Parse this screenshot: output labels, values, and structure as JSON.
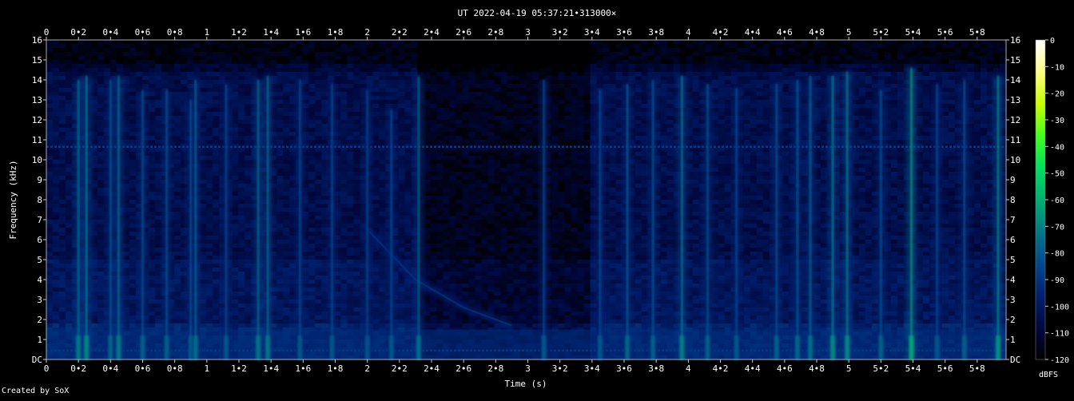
{
  "chart_data": {
    "type": "heatmap",
    "title": "UT 2022-04-19 05:37:21•313000×",
    "xlabel": "Time (s)",
    "ylabel": "Frequency (kHz)",
    "xlim": [
      0,
      5.98
    ],
    "ylim": [
      0,
      16
    ],
    "x_ticks": [
      "0",
      "0•2",
      "0•4",
      "0•6",
      "0•8",
      "1",
      "1•2",
      "1•4",
      "1•6",
      "1•8",
      "2",
      "2•2",
      "2•4",
      "2•6",
      "2•8",
      "3",
      "3•2",
      "3•4",
      "3•6",
      "3•8",
      "4",
      "4•2",
      "4•4",
      "4•6",
      "4•8",
      "5",
      "5•2",
      "5•4",
      "5•6",
      "5•8"
    ],
    "x_tick_values": [
      0,
      0.2,
      0.4,
      0.6,
      0.8,
      1.0,
      1.2,
      1.4,
      1.6,
      1.8,
      2.0,
      2.2,
      2.4,
      2.6,
      2.8,
      3.0,
      3.2,
      3.4,
      3.6,
      3.8,
      4.0,
      4.2,
      4.4,
      4.6,
      4.8,
      5.0,
      5.2,
      5.4,
      5.6,
      5.8
    ],
    "y_ticks": [
      "DC",
      "1",
      "2",
      "3",
      "4",
      "5",
      "6",
      "7",
      "8",
      "9",
      "10",
      "11",
      "12",
      "13",
      "14",
      "15",
      "16"
    ],
    "y_tick_values": [
      0,
      1,
      2,
      3,
      4,
      5,
      6,
      7,
      8,
      9,
      10,
      11,
      12,
      13,
      14,
      15,
      16
    ],
    "colorbar": {
      "label": "dBFS",
      "range": [
        -120,
        0
      ],
      "ticks": [
        "0",
        "-10",
        "-20",
        "-30",
        "-40",
        "-50",
        "-60",
        "-70",
        "-80",
        "-90",
        "-100",
        "-110",
        "-120"
      ],
      "tick_values": [
        0,
        -10,
        -20,
        -30,
        -40,
        -50,
        -60,
        -70,
        -80,
        -90,
        -100,
        -110,
        -120
      ],
      "colors": [
        "#ffffff",
        "#ffff80",
        "#c8ff00",
        "#40ff20",
        "#00e060",
        "#00b070",
        "#007888",
        "#004890",
        "#002070",
        "#000840",
        "#000000"
      ]
    },
    "background_level_dbfs": -110,
    "horizontal_lines": [
      {
        "freq_khz": 10.65,
        "level_dbfs": -88
      },
      {
        "freq_khz": 0.45,
        "level_dbfs": -85
      }
    ],
    "sweep": {
      "description_points_time_s": [
        2.0,
        2.3,
        2.6,
        2.9
      ],
      "description_points_freq_khz": [
        6.5,
        4.0,
        2.6,
        1.7
      ],
      "level_dbfs": -95
    },
    "transients": [
      {
        "t": 0.2,
        "top_khz": 14,
        "level_dbfs": -75
      },
      {
        "t": 0.25,
        "top_khz": 14.2,
        "level_dbfs": -72
      },
      {
        "t": 0.4,
        "top_khz": 14,
        "level_dbfs": -80
      },
      {
        "t": 0.45,
        "top_khz": 14.2,
        "level_dbfs": -75
      },
      {
        "t": 0.6,
        "top_khz": 13.5,
        "level_dbfs": -82
      },
      {
        "t": 0.75,
        "top_khz": 13.5,
        "level_dbfs": -82
      },
      {
        "t": 0.9,
        "top_khz": 13,
        "level_dbfs": -80
      },
      {
        "t": 0.93,
        "top_khz": 14,
        "level_dbfs": -78
      },
      {
        "t": 1.12,
        "top_khz": 13.8,
        "level_dbfs": -84
      },
      {
        "t": 1.32,
        "top_khz": 14,
        "level_dbfs": -76
      },
      {
        "t": 1.38,
        "top_khz": 14.2,
        "level_dbfs": -76
      },
      {
        "t": 1.58,
        "top_khz": 14,
        "level_dbfs": -84
      },
      {
        "t": 1.78,
        "top_khz": 13.8,
        "level_dbfs": -84
      },
      {
        "t": 2.0,
        "top_khz": 13.5,
        "level_dbfs": -85
      },
      {
        "t": 2.15,
        "top_khz": 12.5,
        "level_dbfs": -84
      },
      {
        "t": 2.32,
        "top_khz": 14.2,
        "level_dbfs": -78
      },
      {
        "t": 3.1,
        "top_khz": 14,
        "level_dbfs": -84
      },
      {
        "t": 3.45,
        "top_khz": 13.5,
        "level_dbfs": -84
      },
      {
        "t": 3.62,
        "top_khz": 13.8,
        "level_dbfs": -80
      },
      {
        "t": 3.78,
        "top_khz": 14,
        "level_dbfs": -82
      },
      {
        "t": 3.96,
        "top_khz": 14.2,
        "level_dbfs": -74
      },
      {
        "t": 4.12,
        "top_khz": 13.8,
        "level_dbfs": -82
      },
      {
        "t": 4.3,
        "top_khz": 13.6,
        "level_dbfs": -84
      },
      {
        "t": 4.55,
        "top_khz": 13.8,
        "level_dbfs": -82
      },
      {
        "t": 4.68,
        "top_khz": 14,
        "level_dbfs": -80
      },
      {
        "t": 4.76,
        "top_khz": 14.2,
        "level_dbfs": -78
      },
      {
        "t": 4.9,
        "top_khz": 14.2,
        "level_dbfs": -72
      },
      {
        "t": 4.99,
        "top_khz": 14.4,
        "level_dbfs": -72
      },
      {
        "t": 5.2,
        "top_khz": 13.5,
        "level_dbfs": -82
      },
      {
        "t": 5.39,
        "top_khz": 14.6,
        "level_dbfs": -66
      },
      {
        "t": 5.55,
        "top_khz": 13.8,
        "level_dbfs": -84
      },
      {
        "t": 5.72,
        "top_khz": 14,
        "level_dbfs": -82
      },
      {
        "t": 5.93,
        "top_khz": 14.2,
        "level_dbfs": -70
      }
    ],
    "grid": false
  },
  "footer": {
    "credit": "Created by SoX"
  }
}
